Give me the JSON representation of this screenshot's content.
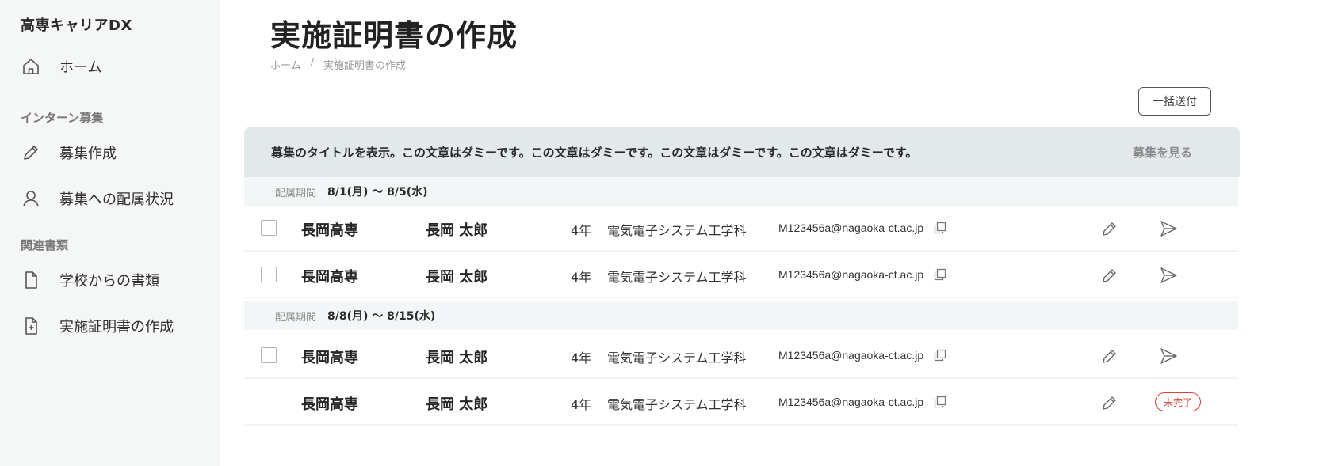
{
  "sidebar": {
    "brand": "高専キャリアDX",
    "items": [
      {
        "label": "ホーム",
        "icon": "home-icon"
      },
      {
        "label": "募集作成",
        "icon": "pencil-icon"
      },
      {
        "label": "募集への配属状況",
        "icon": "user-icon"
      },
      {
        "label": "学校からの書類",
        "icon": "document-icon"
      },
      {
        "label": "実施証明書の作成",
        "icon": "document-add-icon"
      }
    ],
    "sections": [
      "インターン募集",
      "関連書類"
    ]
  },
  "header": {
    "title": "実施証明書の作成",
    "breadcrumb": [
      "ホーム",
      "/",
      "実施証明書の作成"
    ],
    "bulk_send_label": "一括送付"
  },
  "panel": {
    "title": "募集のタイトルを表示。この文章はダミーです。この文章はダミーです。この文章はダミーです。この文章はダミーです。",
    "link_label": "募集を見る"
  },
  "groups": [
    {
      "period_label": "配属期間",
      "period_value": "8/1(月) 〜 8/5(水)",
      "rows": [
        {
          "school": "長岡高専",
          "name": "長岡 太郎",
          "grade": "4年",
          "department": "電気電子システム工学科",
          "email": "M123456a@nagaoka-ct.ac.jp"
        },
        {
          "school": "長岡高専",
          "name": "長岡 太郎",
          "grade": "4年",
          "department": "電気電子システム工学科",
          "email": "M123456a@nagaoka-ct.ac.jp"
        }
      ]
    },
    {
      "period_label": "配属期間",
      "period_value": "8/8(月) 〜 8/15(水)",
      "rows": [
        {
          "school": "長岡高専",
          "name": "長岡 太郎",
          "grade": "4年",
          "department": "電気電子システム工学科",
          "email": "M123456a@nagaoka-ct.ac.jp"
        },
        {
          "school": "長岡高専",
          "name": "長岡 太郎",
          "grade": "4年",
          "department": "電気電子システム工学科",
          "email": "M123456a@nagaoka-ct.ac.jp",
          "status": "未完了"
        }
      ]
    }
  ],
  "colors": {
    "sidebar_bg": "#f5f6f6",
    "panel_bg": "#e3e9eb",
    "period_bg": "#f3f6f7",
    "status_incomplete": "#e0403a"
  }
}
